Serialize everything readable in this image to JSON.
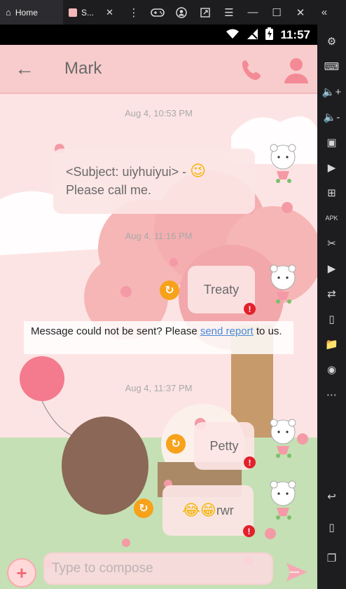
{
  "emulator": {
    "tabs": [
      {
        "label": "Home"
      },
      {
        "label": "S..."
      }
    ]
  },
  "status_bar": {
    "time": "11:57"
  },
  "header": {
    "contact_name": "Mark"
  },
  "messages": [
    {
      "timestamp": "Aug 4, 10:53 PM",
      "text": "<Subject: uiyhuiyui> - 😉\nPlease call me.",
      "subject_line": "<Subject: uiyhuiyui> -",
      "emoji": "😉",
      "body_line": "Please call me."
    },
    {
      "timestamp": "Aug 4, 11:16 PM",
      "text": "Treaty",
      "failed": true
    },
    {
      "timestamp": "Aug 4, 11:37 PM",
      "text": "Petty",
      "failed": true
    },
    {
      "text": "😂😁rwr",
      "emoji": "😂😁",
      "suffix": "rwr",
      "failed": true
    }
  ],
  "error_banner": {
    "prefix": "Message could not be sent? Please ",
    "link": "send report",
    "suffix": " to us."
  },
  "compose": {
    "placeholder": "Type to compose"
  },
  "colors": {
    "appbar": "#f8cccc",
    "accent_pink": "#f48a96",
    "retry_orange": "#f7a21a",
    "error_red": "#e3202b",
    "link_blue": "#4a88d8"
  }
}
